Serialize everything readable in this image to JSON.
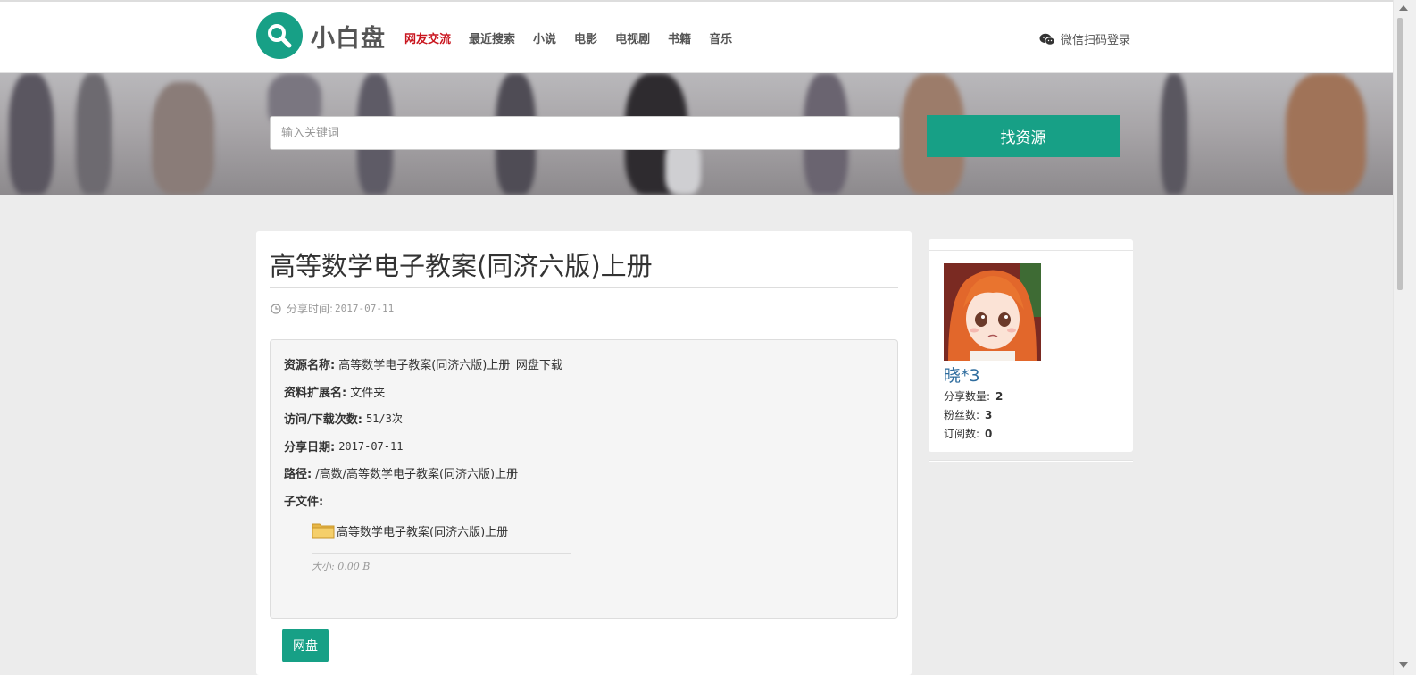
{
  "header": {
    "logo_text": "小白盘",
    "nav": [
      {
        "label": "网友交流",
        "active": true
      },
      {
        "label": "最近搜索",
        "active": false
      },
      {
        "label": "小说",
        "active": false
      },
      {
        "label": "电影",
        "active": false
      },
      {
        "label": "电视剧",
        "active": false
      },
      {
        "label": "书籍",
        "active": false
      },
      {
        "label": "音乐",
        "active": false
      }
    ],
    "login_label": "微信扫码登录"
  },
  "search": {
    "placeholder": "输入关键词",
    "button_label": "找资源"
  },
  "resource": {
    "title": "高等数学电子教案(同济六版)上册",
    "share_time_label": "分享时间:",
    "share_time": "2017-07-11",
    "fields": {
      "name_label": "资源名称:",
      "name_value": "高等数学电子教案(同济六版)上册_网盘下载",
      "ext_label": "资料扩展名:",
      "ext_value": "文件夹",
      "visits_label": "访问/下载次数:",
      "visits_value": "51/3次",
      "date_label": "分享日期:",
      "date_value": "2017-07-11",
      "path_label": "路径:",
      "path_value": "/高数/高等数学电子教案(同济六版)上册",
      "children_label": "子文件:"
    },
    "child_file": {
      "name": "高等数学电子教案(同济六版)上册",
      "size": "大小: 0.00 B"
    },
    "pan_button_label": "网盘"
  },
  "sharer": {
    "name": "晓*3",
    "stats": [
      {
        "label": "分享数量:",
        "value": "2"
      },
      {
        "label": "粉丝数:",
        "value": "3"
      },
      {
        "label": "订阅数:",
        "value": "0"
      }
    ]
  },
  "colors": {
    "brand": "#17a086",
    "nav_active": "#c9151e",
    "username": "#2f6d9e"
  }
}
